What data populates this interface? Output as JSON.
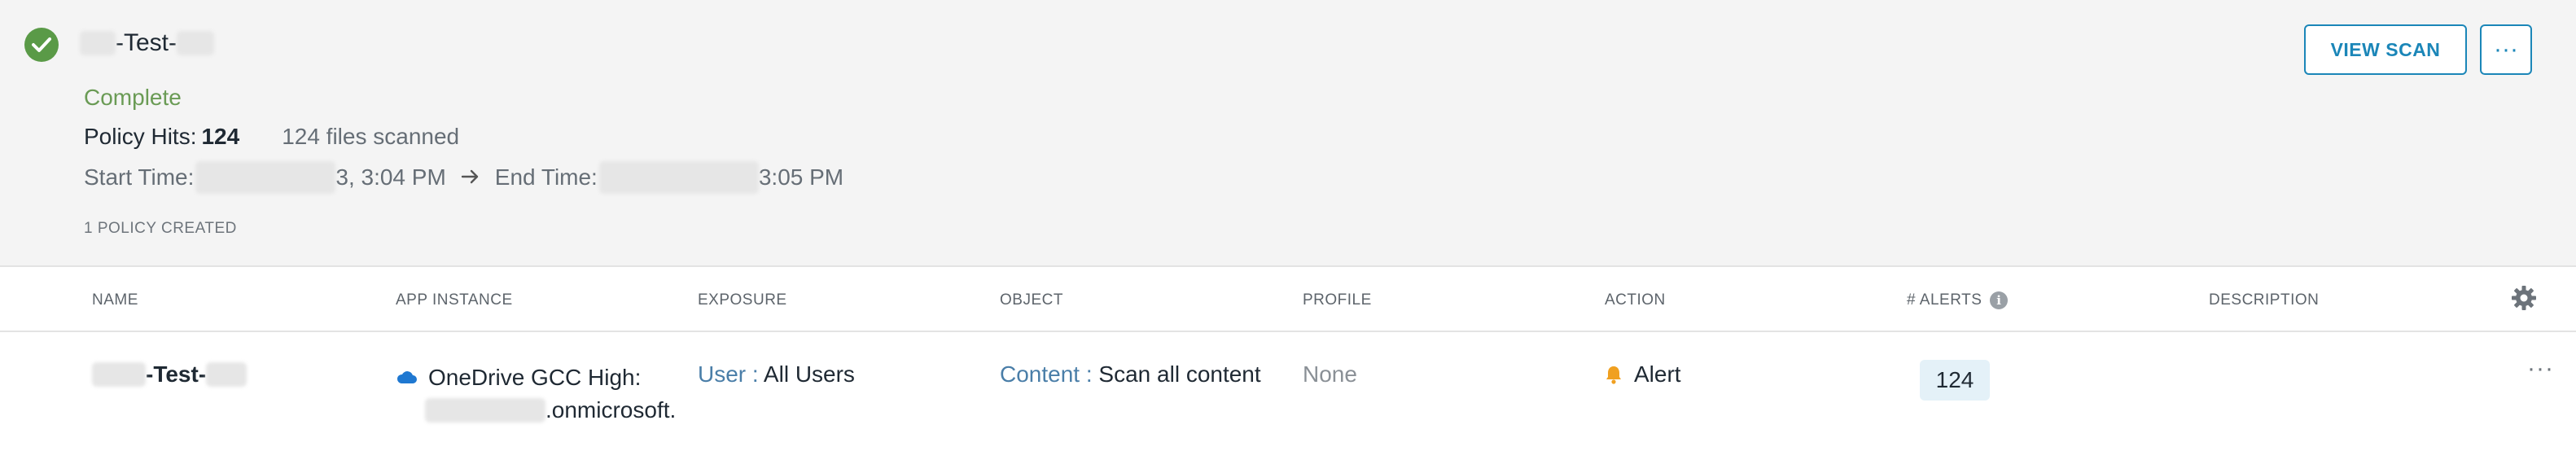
{
  "scan": {
    "title": "-Test-",
    "status": "Complete",
    "policy_hits_label": "Policy Hits:",
    "policy_hits_value": "124",
    "files_scanned": "124 files scanned",
    "start_time_label": "Start Time:",
    "start_time_value": "3, 3:04 PM",
    "end_time_label": "End Time:",
    "end_time_value": "3:05 PM",
    "policies_created": "1 POLICY CREATED"
  },
  "actions": {
    "view_scan_label": "VIEW SCAN",
    "more_label": "···"
  },
  "table": {
    "columns": [
      "NAME",
      "APP INSTANCE",
      "EXPOSURE",
      "OBJECT",
      "PROFILE",
      "ACTION",
      "# ALERTS",
      "DESCRIPTION"
    ],
    "rows": [
      {
        "name": "-Test-",
        "app_instance_line1": "OneDrive GCC High:",
        "app_instance_line2": ".onmicrosoft.",
        "exposure_label": "User :",
        "exposure_value": "All Users",
        "object_label": "Content :",
        "object_value": "Scan all content",
        "profile": "None",
        "action": "Alert",
        "alerts": "124",
        "description": "",
        "more_label": "···"
      }
    ]
  },
  "colors": {
    "success": "#5a9a47",
    "accent": "#1b86b8",
    "alert": "#f0a020",
    "onedrive": "#1f78d1"
  },
  "icons": [
    "check-icon",
    "arrow-right-icon",
    "info-icon",
    "gear-icon",
    "onedrive-cloud-icon",
    "bell-icon",
    "more-icon"
  ]
}
